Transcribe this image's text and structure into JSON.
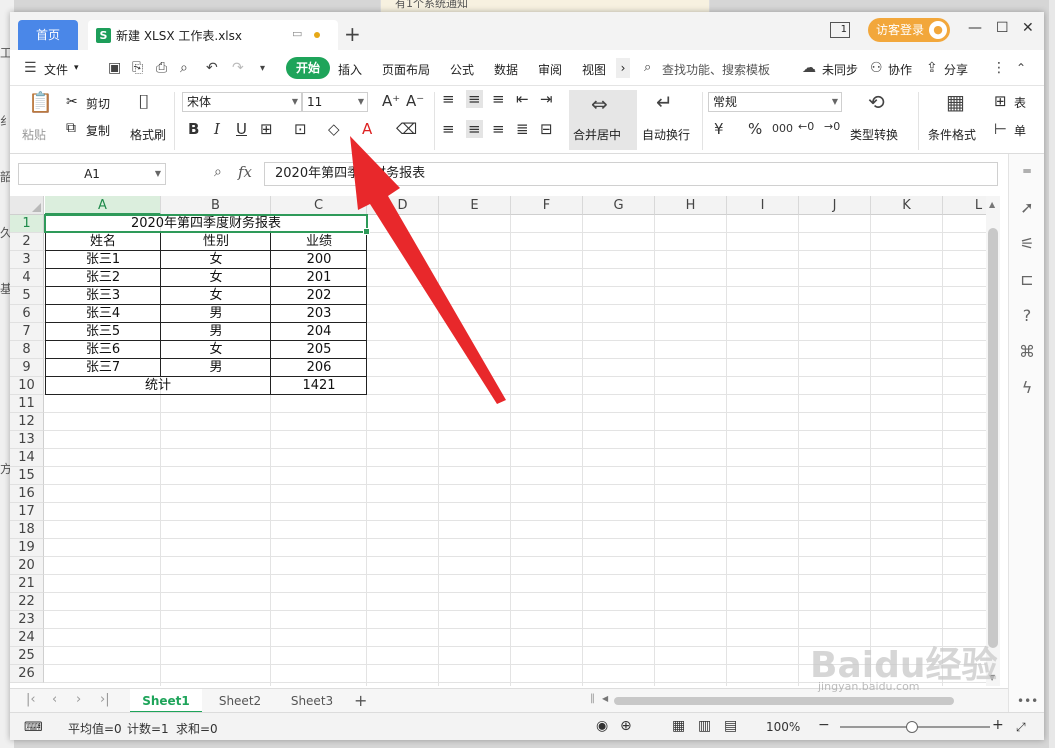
{
  "background": {
    "top_fragment": "有1个系统通知"
  },
  "titlebar": {
    "home_tab": "首页",
    "doc_tab_icon": "S",
    "doc_tab": "新建 XLSX 工作表.xlsx",
    "add_tab": "+",
    "pages_icon": "1",
    "login": "访客登录"
  },
  "menubar": {
    "file": "文件",
    "items": [
      "开始",
      "插入",
      "页面布局",
      "公式",
      "数据",
      "审阅",
      "视图"
    ],
    "search": "查找功能、搜索模板",
    "sync": "未同步",
    "collab": "协作",
    "share": "分享"
  },
  "ribbon": {
    "paste": "粘贴",
    "cut": "剪切",
    "copy": "复制",
    "format_painter": "格式刷",
    "font_name": "宋体",
    "font_size": "11",
    "merge_center": "合并居中",
    "wrap_text": "自动换行",
    "number_format": "常规",
    "currency": "¥",
    "percent": "%",
    "thousands": "000",
    "type_convert": "类型转换",
    "cond_format": "条件格式",
    "table_style": "表",
    "cell": "单"
  },
  "formula_bar": {
    "name_box": "A1",
    "fx": "fx",
    "content": "2020年第四季度财务报表"
  },
  "grid": {
    "columns": [
      "A",
      "B",
      "C",
      "D",
      "E",
      "F",
      "G",
      "H",
      "I",
      "J",
      "K",
      "L"
    ],
    "rows": [
      "1",
      "2",
      "3",
      "4",
      "5",
      "6",
      "7",
      "8",
      "9",
      "10",
      "11",
      "12",
      "13",
      "14",
      "15",
      "16",
      "17",
      "18",
      "19",
      "20",
      "21",
      "22",
      "23",
      "24",
      "25",
      "26"
    ],
    "title": "2020年第四季度财务报表",
    "headers": [
      "姓名",
      "性别",
      "业绩"
    ],
    "data": [
      [
        "张三1",
        "女",
        "200"
      ],
      [
        "张三2",
        "女",
        "201"
      ],
      [
        "张三3",
        "女",
        "202"
      ],
      [
        "张三4",
        "男",
        "203"
      ],
      [
        "张三5",
        "男",
        "204"
      ],
      [
        "张三6",
        "女",
        "205"
      ],
      [
        "张三7",
        "男",
        "206"
      ]
    ],
    "total_label": "统计",
    "total_value": "1421"
  },
  "sheets": {
    "tabs": [
      "Sheet1",
      "Sheet2",
      "Sheet3"
    ],
    "active": "Sheet1",
    "add": "+"
  },
  "status": {
    "average": "平均值=0",
    "count": "计数=1",
    "sum": "求和=0",
    "zoom": "100%"
  },
  "watermark": {
    "brand": "Baidu经验",
    "url": "jingyan.baidu.com"
  },
  "colors": {
    "accent_green": "#1ea45a",
    "home_tab_blue": "#4a87e8",
    "login_orange": "#f2a73b",
    "arrow_red": "#e8282b"
  }
}
